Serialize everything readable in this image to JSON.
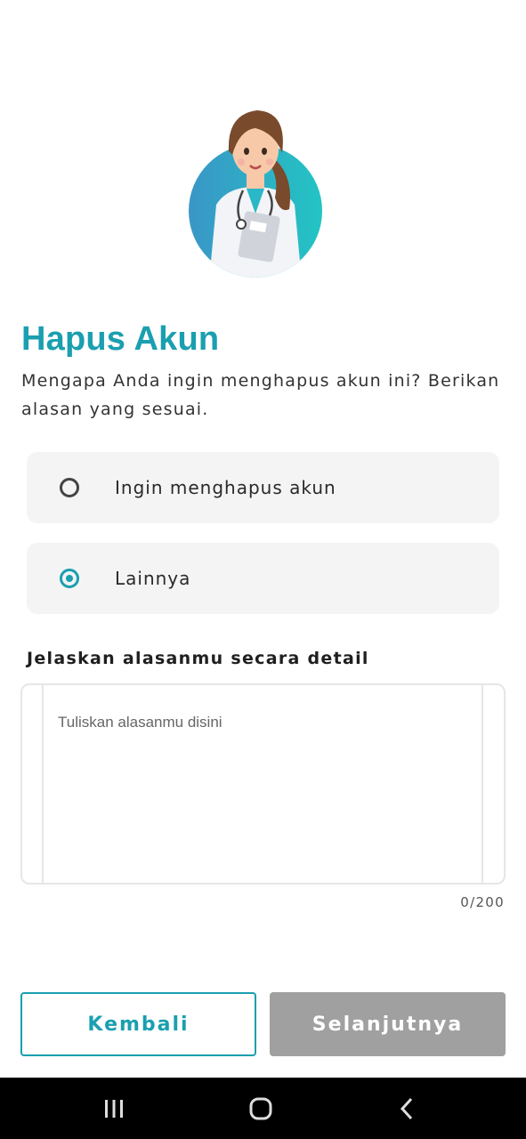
{
  "page": {
    "title": "Hapus Akun",
    "subtitle": "Mengapa Anda ingin menghapus akun ini? Berikan alasan yang sesuai."
  },
  "options": [
    {
      "label": "Ingin menghapus akun",
      "selected": false
    },
    {
      "label": "Lainnya",
      "selected": true
    }
  ],
  "detail": {
    "label": "Jelaskan alasanmu secara detail",
    "placeholder": "Tuliskan alasanmu disini",
    "value": "",
    "counter": "0/200"
  },
  "buttons": {
    "back_label": "Kembali",
    "next_label": "Selanjutnya"
  },
  "navbar": {
    "icons": [
      "recent-apps-icon",
      "home-icon",
      "back-icon"
    ]
  },
  "colors": {
    "accent": "#1a9fb0",
    "disabled_button": "#a0a0a0",
    "option_bg": "#f4f4f4"
  }
}
